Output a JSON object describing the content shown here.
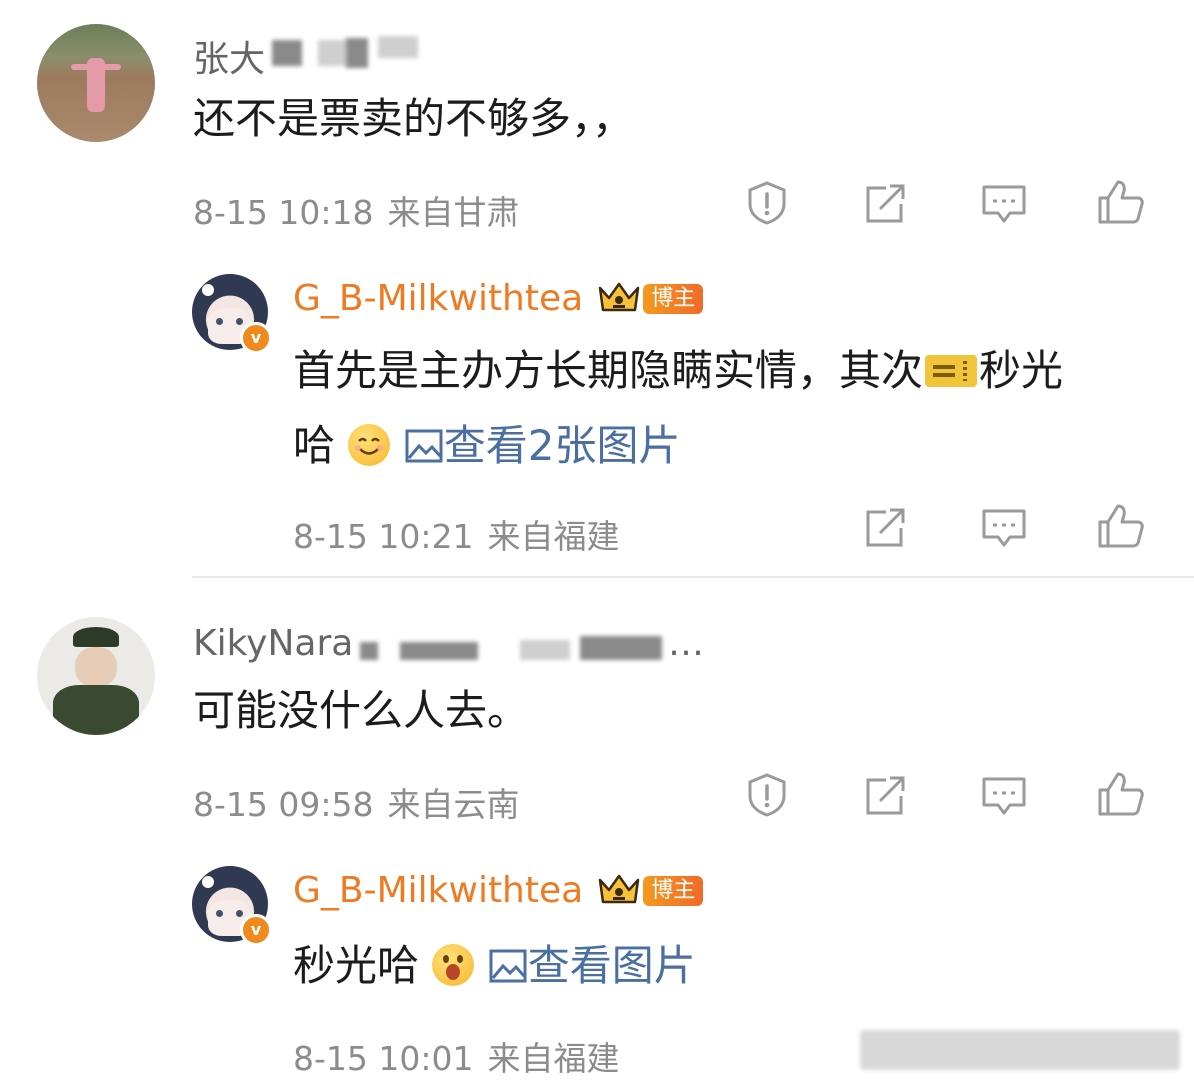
{
  "comments": [
    {
      "name": "张大",
      "text": "还不是票卖的不够多，，",
      "time": "8-15 10:18",
      "location": "来自甘肃",
      "reply": {
        "name": "G_B-Milkwithtea",
        "badge": "博主",
        "text_part1": "首先是主办方长期隐瞒实情，其次",
        "text_part2": "秒光",
        "text_line2": "哈",
        "link": "查看2张图片",
        "time": "8-15 10:21",
        "location": "来自福建"
      }
    },
    {
      "name": "KikyNara",
      "name_trail": "…",
      "text": "可能没什么人去。",
      "time": "8-15 09:58",
      "location": "来自云南",
      "reply": {
        "name": "G_B-Milkwithtea",
        "badge": "博主",
        "text": "秒光哈",
        "link": "查看图片",
        "time": "8-15 10:01",
        "location": "来自福建"
      }
    }
  ],
  "icons": {
    "report": "report-icon",
    "share": "share-icon",
    "comment": "comment-icon",
    "like": "like-icon",
    "image": "image-icon",
    "crown": "crown-icon",
    "verified": "verified-icon"
  },
  "colors": {
    "accent_orange": "#ee7a22",
    "link_blue": "#4c6fa3",
    "meta_gray": "#8c8c8c"
  }
}
